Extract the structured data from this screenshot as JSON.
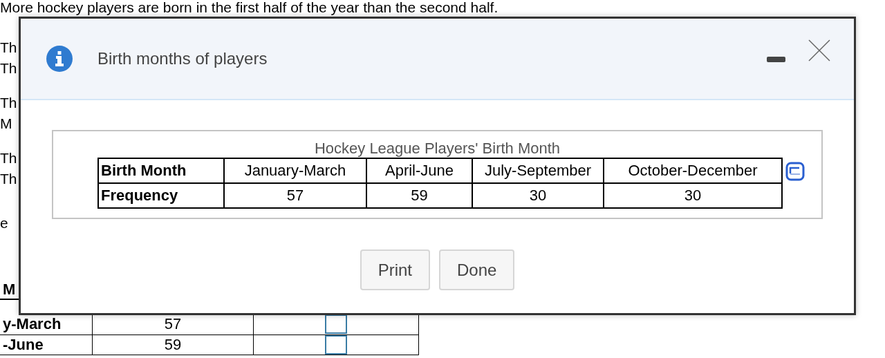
{
  "page": {
    "intro": "More hockey players are born in the first half of the year than the second half.",
    "fragments": [
      "Th",
      "Th",
      "Th",
      "M",
      "Th",
      "Th",
      "e"
    ],
    "table": {
      "header": "M",
      "rows": [
        {
          "label": "y-March",
          "value": "57"
        },
        {
          "label": "-June",
          "value": "59"
        }
      ]
    }
  },
  "dialog": {
    "title": "Birth months of players",
    "caption": "Hockey League Players' Birth Month",
    "table": {
      "rows": [
        {
          "label": "Birth Month",
          "cells": [
            "January-March",
            "April-June",
            "July-September",
            "October-December"
          ]
        },
        {
          "label": "Frequency",
          "cells": [
            "57",
            "59",
            "30",
            "30"
          ]
        }
      ]
    },
    "buttons": [
      "Print",
      "Done"
    ]
  }
}
